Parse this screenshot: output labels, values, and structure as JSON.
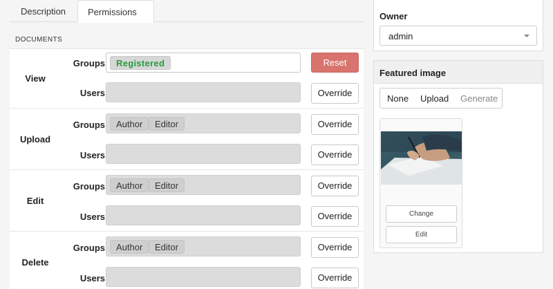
{
  "tabs": [
    {
      "label": "Description"
    },
    {
      "label": "Permissions"
    }
  ],
  "section_title": "DOCUMENTS",
  "permissions": [
    {
      "action": "View",
      "groups_label": "Groups",
      "users_label": "Users",
      "groups": [
        "Registered"
      ],
      "groups_button": "Reset",
      "users_button": "Override"
    },
    {
      "action": "Upload",
      "groups_label": "Groups",
      "users_label": "Users",
      "groups": [
        "Author",
        "Editor"
      ],
      "groups_button": "Override",
      "users_button": "Override"
    },
    {
      "action": "Edit",
      "groups_label": "Groups",
      "users_label": "Users",
      "groups": [
        "Author",
        "Editor"
      ],
      "groups_button": "Override",
      "users_button": "Override"
    },
    {
      "action": "Delete",
      "groups_label": "Groups",
      "users_label": "Users",
      "groups": [
        "Author",
        "Editor"
      ],
      "groups_button": "Override",
      "users_button": "Override"
    }
  ],
  "owner": {
    "label": "Owner",
    "value": "admin"
  },
  "featured_image": {
    "title": "Featured image",
    "options": [
      "None",
      "Upload",
      "Generate"
    ],
    "change_label": "Change",
    "edit_label": "Edit"
  },
  "colors": {
    "reset_button": "#d9736e",
    "registered_tag_text": "#2a9a3f"
  }
}
